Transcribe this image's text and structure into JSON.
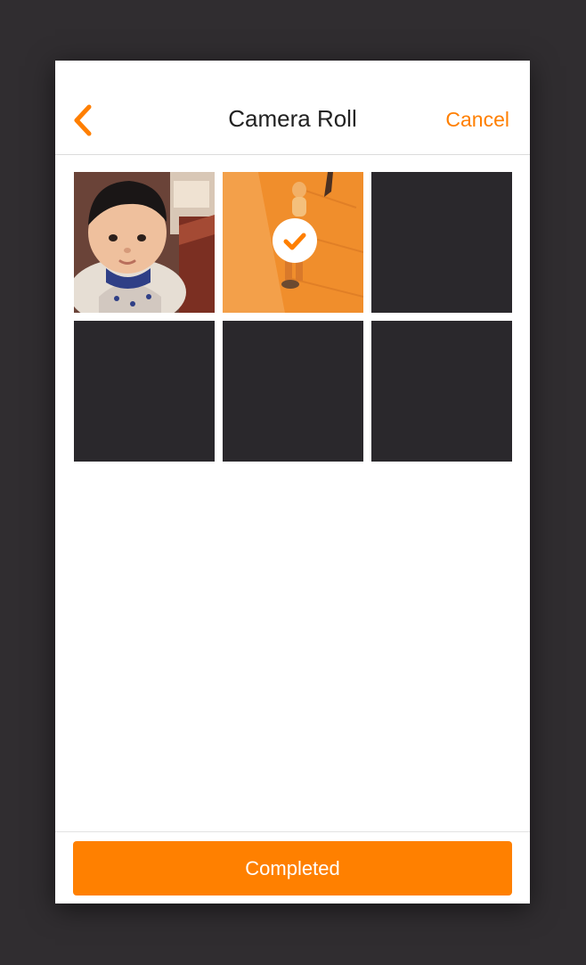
{
  "nav": {
    "title": "Camera Roll",
    "cancel_label": "Cancel",
    "back_icon": "chevron-left-icon"
  },
  "grid": {
    "photos": [
      {
        "content": "child-portrait-photo",
        "selected": false
      },
      {
        "content": "child-on-path-photo",
        "selected": true
      },
      {
        "content": "empty",
        "selected": false
      },
      {
        "content": "empty",
        "selected": false
      },
      {
        "content": "empty",
        "selected": false
      },
      {
        "content": "empty",
        "selected": false
      }
    ]
  },
  "footer": {
    "completed_label": "Completed"
  },
  "colors": {
    "accent": "#ff8000",
    "empty_tile": "#2a282c",
    "backdrop": "#302d30"
  }
}
